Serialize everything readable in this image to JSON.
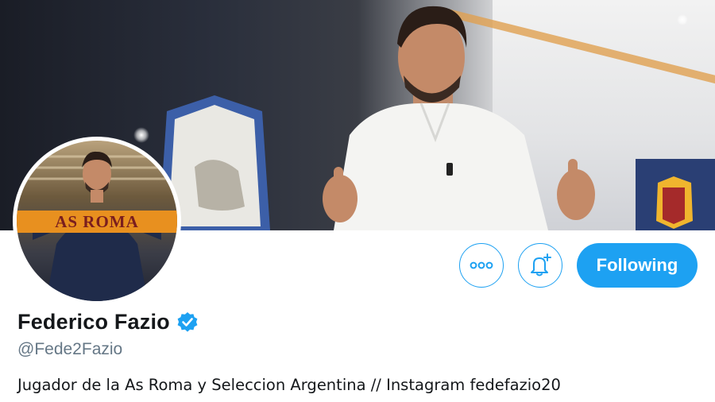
{
  "profile": {
    "display_name": "Federico Fazio",
    "handle": "@Fede2Fazio",
    "bio": "Jugador de la As Roma y Seleccion Argentina // Instagram fedefazio20",
    "verified": true
  },
  "actions": {
    "more_icon": "more-dots-icon",
    "notify_icon": "bell-plus-icon",
    "following_label": "Following"
  },
  "avatar": {
    "scarf_text": "AS ROMA"
  },
  "colors": {
    "accent": "#1da1f2",
    "text_primary": "#14171a",
    "text_secondary": "#657786",
    "scarf": "#e8901f",
    "scarf_text": "#7a1e1e"
  }
}
